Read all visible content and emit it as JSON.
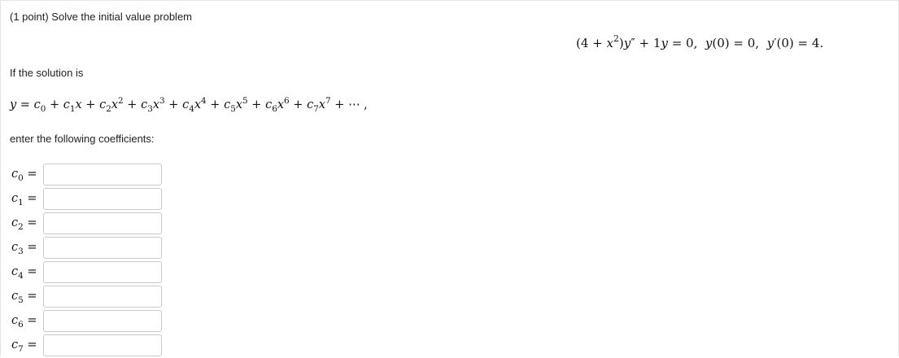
{
  "problem": {
    "header": "(1 point) Solve the initial value problem",
    "ivp_equation": "(4 + x²)y″ + 1y = 0, y(0) = 0, y′(0) = 4.",
    "if_text": "If the solution is",
    "series_expression": "y = c₀ + c₁x + c₂x² + c₃x³ + c₄x⁴ + c₅x⁵ + c₆x⁶ + c₇x⁷ + ⋯ ,",
    "enter_text": "enter the following coefficients:"
  },
  "coefficients": [
    {
      "label": "c0 =",
      "value": ""
    },
    {
      "label": "c1 =",
      "value": ""
    },
    {
      "label": "c2 =",
      "value": ""
    },
    {
      "label": "c3 =",
      "value": ""
    },
    {
      "label": "c4 =",
      "value": ""
    },
    {
      "label": "c5 =",
      "value": ""
    },
    {
      "label": "c6 =",
      "value": ""
    },
    {
      "label": "c7 =",
      "value": ""
    }
  ]
}
